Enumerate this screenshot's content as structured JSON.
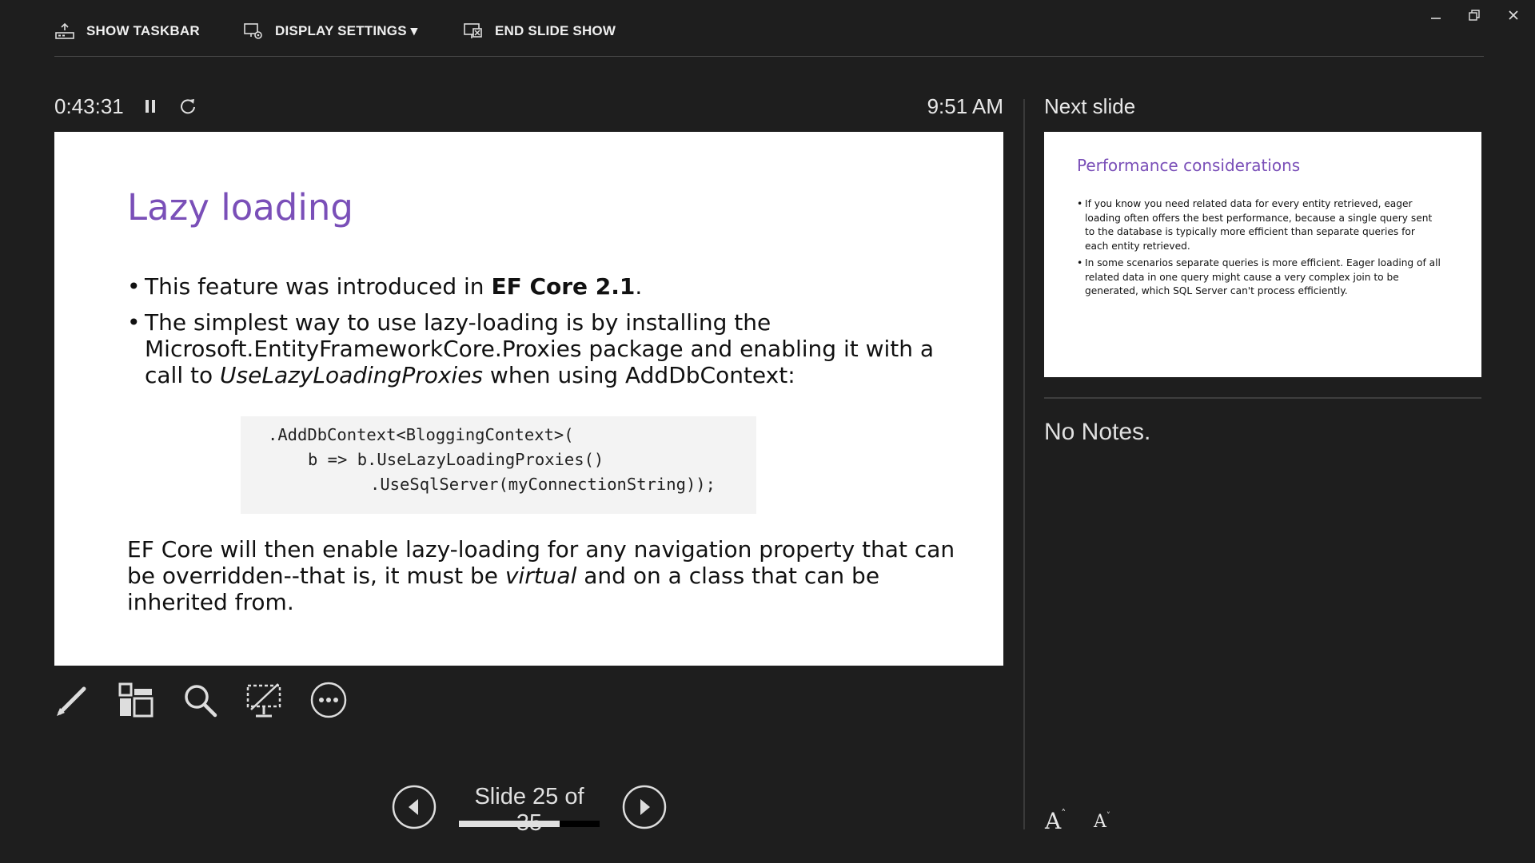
{
  "toolbar": {
    "show_taskbar": "SHOW TASKBAR",
    "display_settings": "DISPLAY SETTINGS ▾",
    "end_slide_show": "END SLIDE SHOW"
  },
  "window_controls": {
    "minimize_icon": "minimize-icon",
    "restore_icon": "restore-icon",
    "close_icon": "close-icon"
  },
  "timer": {
    "elapsed": "0:43:31",
    "pause_icon": "pause-icon",
    "restart_icon": "restart-icon",
    "clock": "9:51 AM"
  },
  "current_slide": {
    "title": "Lazy loading",
    "bullet1_pre": "This feature was introduced in ",
    "bullet1_bold": "EF Core 2.1",
    "bullet1_post": ".",
    "bullet2_pre": "The simplest way to use lazy-loading is by installing the Microsoft.EntityFrameworkCore.Proxies package and enabling it with a call to ",
    "bullet2_italic": "UseLazyLoadingProxies",
    "bullet2_post": " when using AddDbContext:",
    "code": [
      ".AddDbContext<BloggingContext>(",
      "b => b.UseLazyLoadingProxies()",
      ".UseSqlServer(myConnectionString));"
    ],
    "para_pre": "EF Core will then enable lazy-loading for any navigation property that can be overridden--that is, it must be ",
    "para_italic": "virtual",
    "para_post": " and on a class that can be inherited from."
  },
  "next_slide": {
    "label": "Next slide",
    "title": "Performance considerations",
    "bullets": [
      "If you know you need related data for every entity retrieved, eager loading often offers the best performance, because a single query sent to the database is typically more efficient than separate queries for each entity retrieved.",
      "In some scenarios separate queries is more efficient. Eager loading of all related data in one query might cause a very complex join to be generated, which SQL Server can't process efficiently."
    ]
  },
  "notes": {
    "text": "No Notes.",
    "increase_font": "A",
    "decrease_font": "A"
  },
  "tools": [
    "pen-icon",
    "see-all-slides-icon",
    "zoom-icon",
    "black-screen-icon",
    "more-options-icon"
  ],
  "navigation": {
    "slide_count": "Slide 25 of 35",
    "progress": 0.714
  },
  "colors": {
    "background": "#1e1e1e",
    "title_accent": "#7a4fb8"
  }
}
